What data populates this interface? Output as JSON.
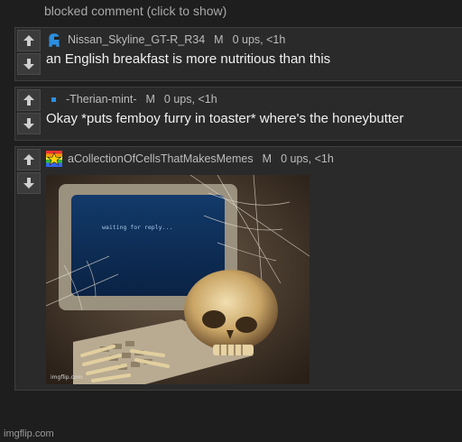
{
  "blocked_comment": "blocked comment (click to show)",
  "comments": [
    {
      "username": "Nissan_Skyline_GT-R_R34",
      "mod_badge": "M",
      "stats": "0 ups, <1h",
      "text": "an English breakfast is more nutritious than this",
      "avatar": "blue-ghost-avatar",
      "avatar_color": "#2b8fe0"
    },
    {
      "username": "-Therian-mint-",
      "mod_badge": "M",
      "stats": "0 ups, <1h",
      "text": "Okay *puts femboy furry in toaster* where's the honeybutter",
      "avatar": "small-blue-square-avatar",
      "avatar_color": "#2b8fe0"
    },
    {
      "username": "aCollectionOfCellsThatMakesMemes",
      "mod_badge": "M",
      "stats": "0 ups, <1h",
      "image": {
        "screen_text": "waiting for reply...",
        "watermark": "imgflip.com"
      },
      "avatar": "rainbow-star-avatar"
    }
  ],
  "footer": "imgflip.com",
  "colors": {
    "background": "#1e1e1e",
    "comment_bg": "#2a2a2a",
    "vote_button": "#3b3b3b"
  }
}
